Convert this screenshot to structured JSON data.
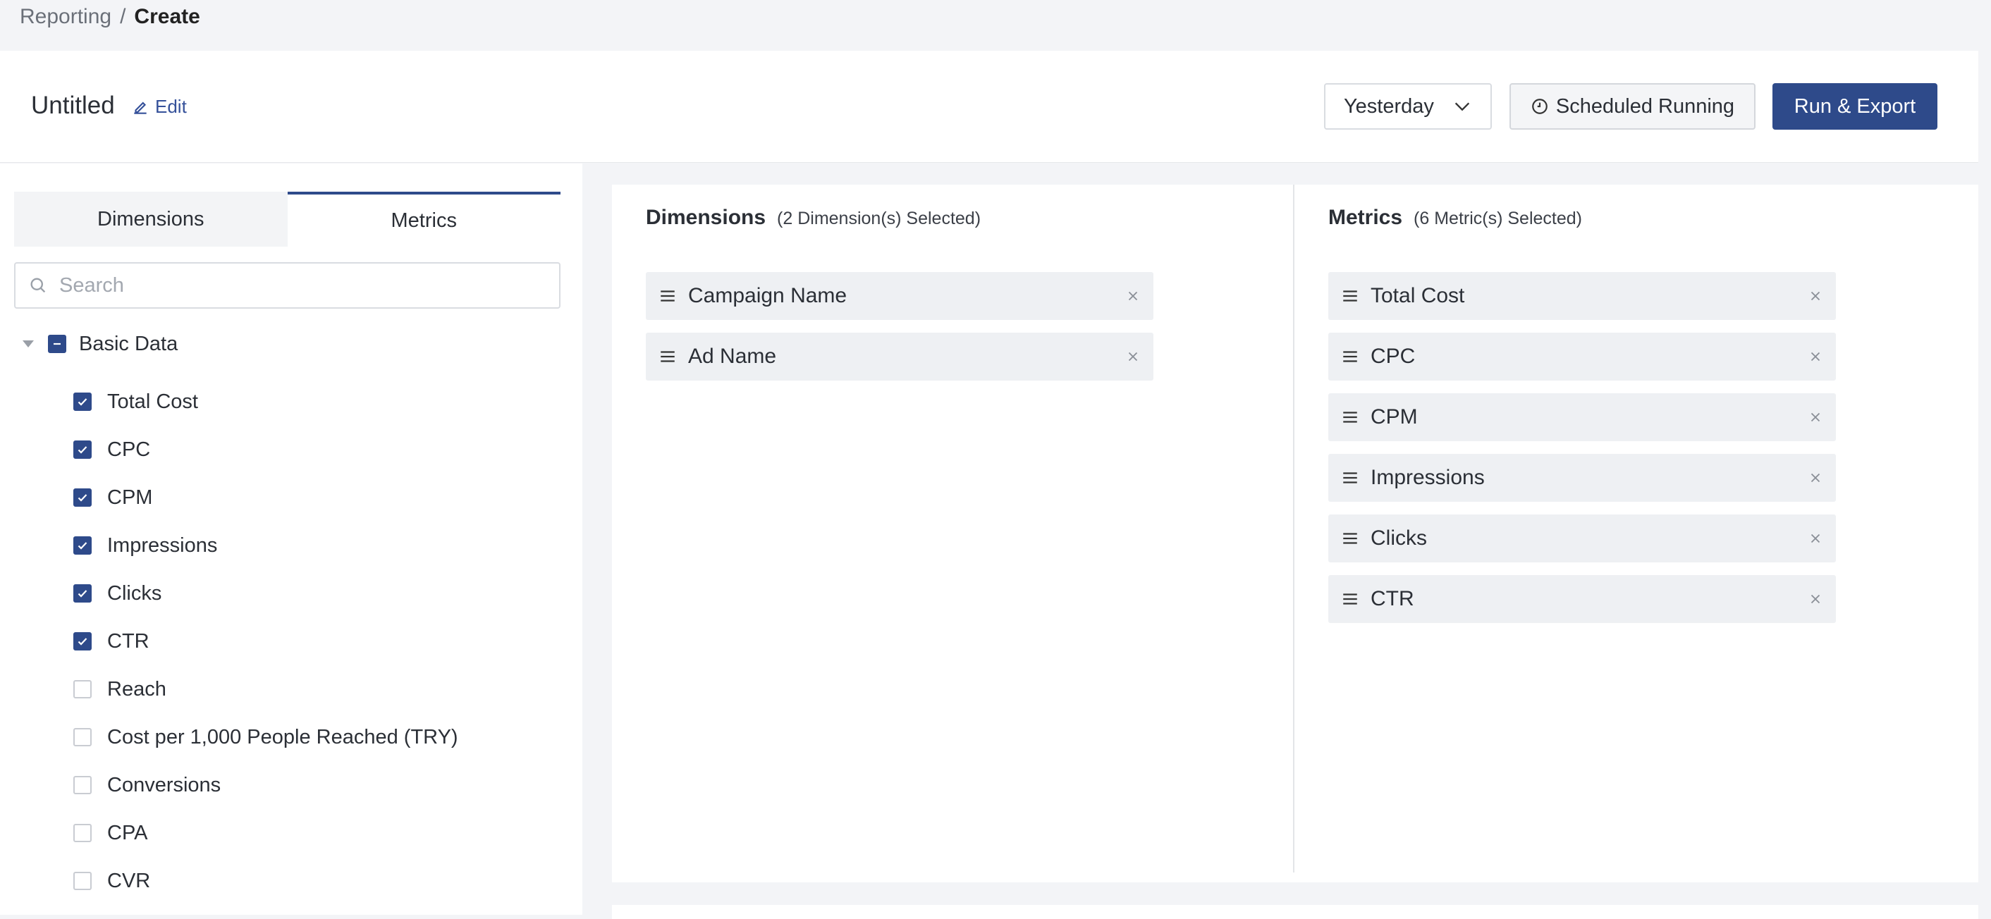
{
  "breadcrumb": {
    "parent": "Reporting",
    "separator": "/",
    "current": "Create"
  },
  "header": {
    "title": "Untitled",
    "edit_label": "Edit",
    "date_range": "Yesterday",
    "scheduled_label": "Scheduled Running",
    "run_label": "Run & Export"
  },
  "left": {
    "tabs": [
      {
        "label": "Dimensions"
      },
      {
        "label": "Metrics"
      }
    ],
    "active_tab": "Metrics",
    "search_placeholder": "Search",
    "group": {
      "label": "Basic Data",
      "state": "indeterminate"
    },
    "metrics": [
      {
        "label": "Total Cost",
        "checked": true
      },
      {
        "label": "CPC",
        "checked": true
      },
      {
        "label": "CPM",
        "checked": true
      },
      {
        "label": "Impressions",
        "checked": true
      },
      {
        "label": "Clicks",
        "checked": true
      },
      {
        "label": "CTR",
        "checked": true
      },
      {
        "label": "Reach",
        "checked": false
      },
      {
        "label": "Cost per 1,000 People Reached (TRY)",
        "checked": false
      },
      {
        "label": "Conversions",
        "checked": false
      },
      {
        "label": "CPA",
        "checked": false
      },
      {
        "label": "CVR",
        "checked": false
      }
    ]
  },
  "selected": {
    "dimensions": {
      "heading": "Dimensions",
      "count_text": "(2 Dimension(s) Selected)",
      "items": [
        {
          "label": "Campaign Name"
        },
        {
          "label": "Ad Name"
        }
      ]
    },
    "metrics": {
      "heading": "Metrics",
      "count_text": "(6 Metric(s) Selected)",
      "items": [
        {
          "label": "Total Cost"
        },
        {
          "label": "CPC"
        },
        {
          "label": "CPM"
        },
        {
          "label": "Impressions"
        },
        {
          "label": "Clicks"
        },
        {
          "label": "CTR"
        }
      ]
    }
  },
  "colors": {
    "primary": "#2e4a8a",
    "chip_bg": "#eef0f3",
    "page_bg": "#f3f4f7"
  }
}
